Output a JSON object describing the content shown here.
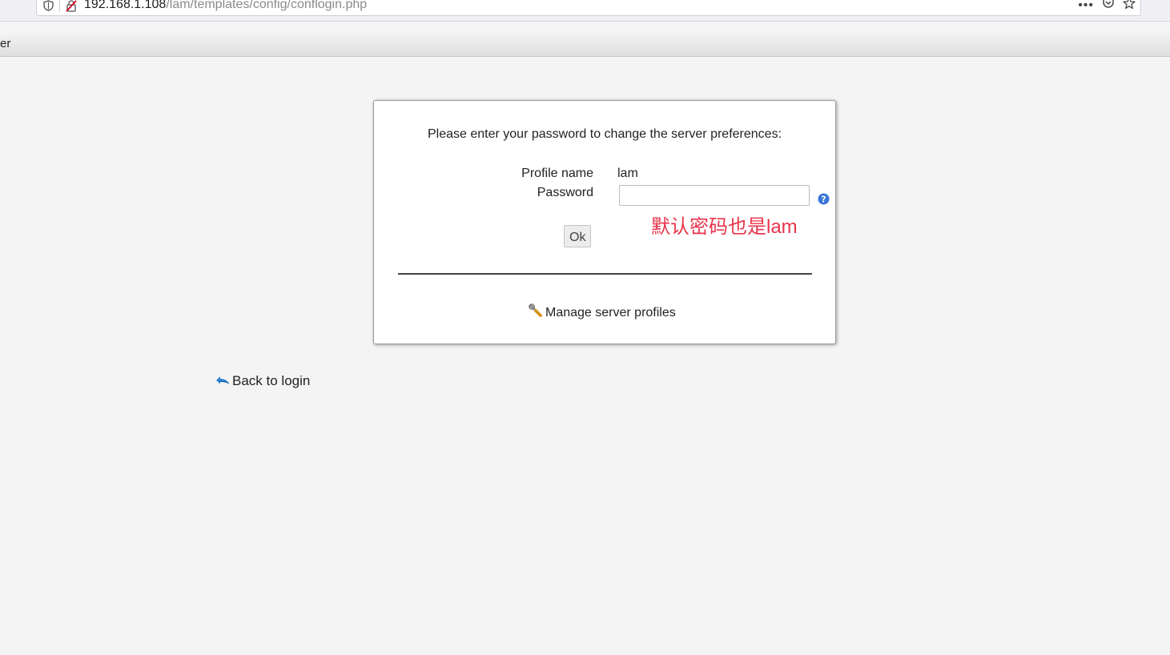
{
  "browser": {
    "url_host": "192.168.1.108",
    "url_path": "/lam/templates/config/conflogin.php",
    "menu_glyph": "•••"
  },
  "tab_strip": {
    "text": "er"
  },
  "dialog": {
    "title": "Please enter your password to change the server preferences:",
    "profile_label": "Profile name",
    "profile_value": "lam",
    "password_label": "Password",
    "password_value": "",
    "annotation": "默认密码也是lam",
    "ok_label": "Ok",
    "manage_label": "Manage server profiles"
  },
  "footer": {
    "back_label": "Back to login"
  },
  "colors": {
    "annotation": "#e8334a",
    "help_icon": "#3a76d8",
    "background": "#f4f4f4"
  },
  "icons": [
    "shield-icon",
    "insecure-connection-icon",
    "more-icon",
    "pocket-icon",
    "bookmark-star-icon",
    "help-icon",
    "wrench-icon",
    "back-arrow-icon"
  ]
}
